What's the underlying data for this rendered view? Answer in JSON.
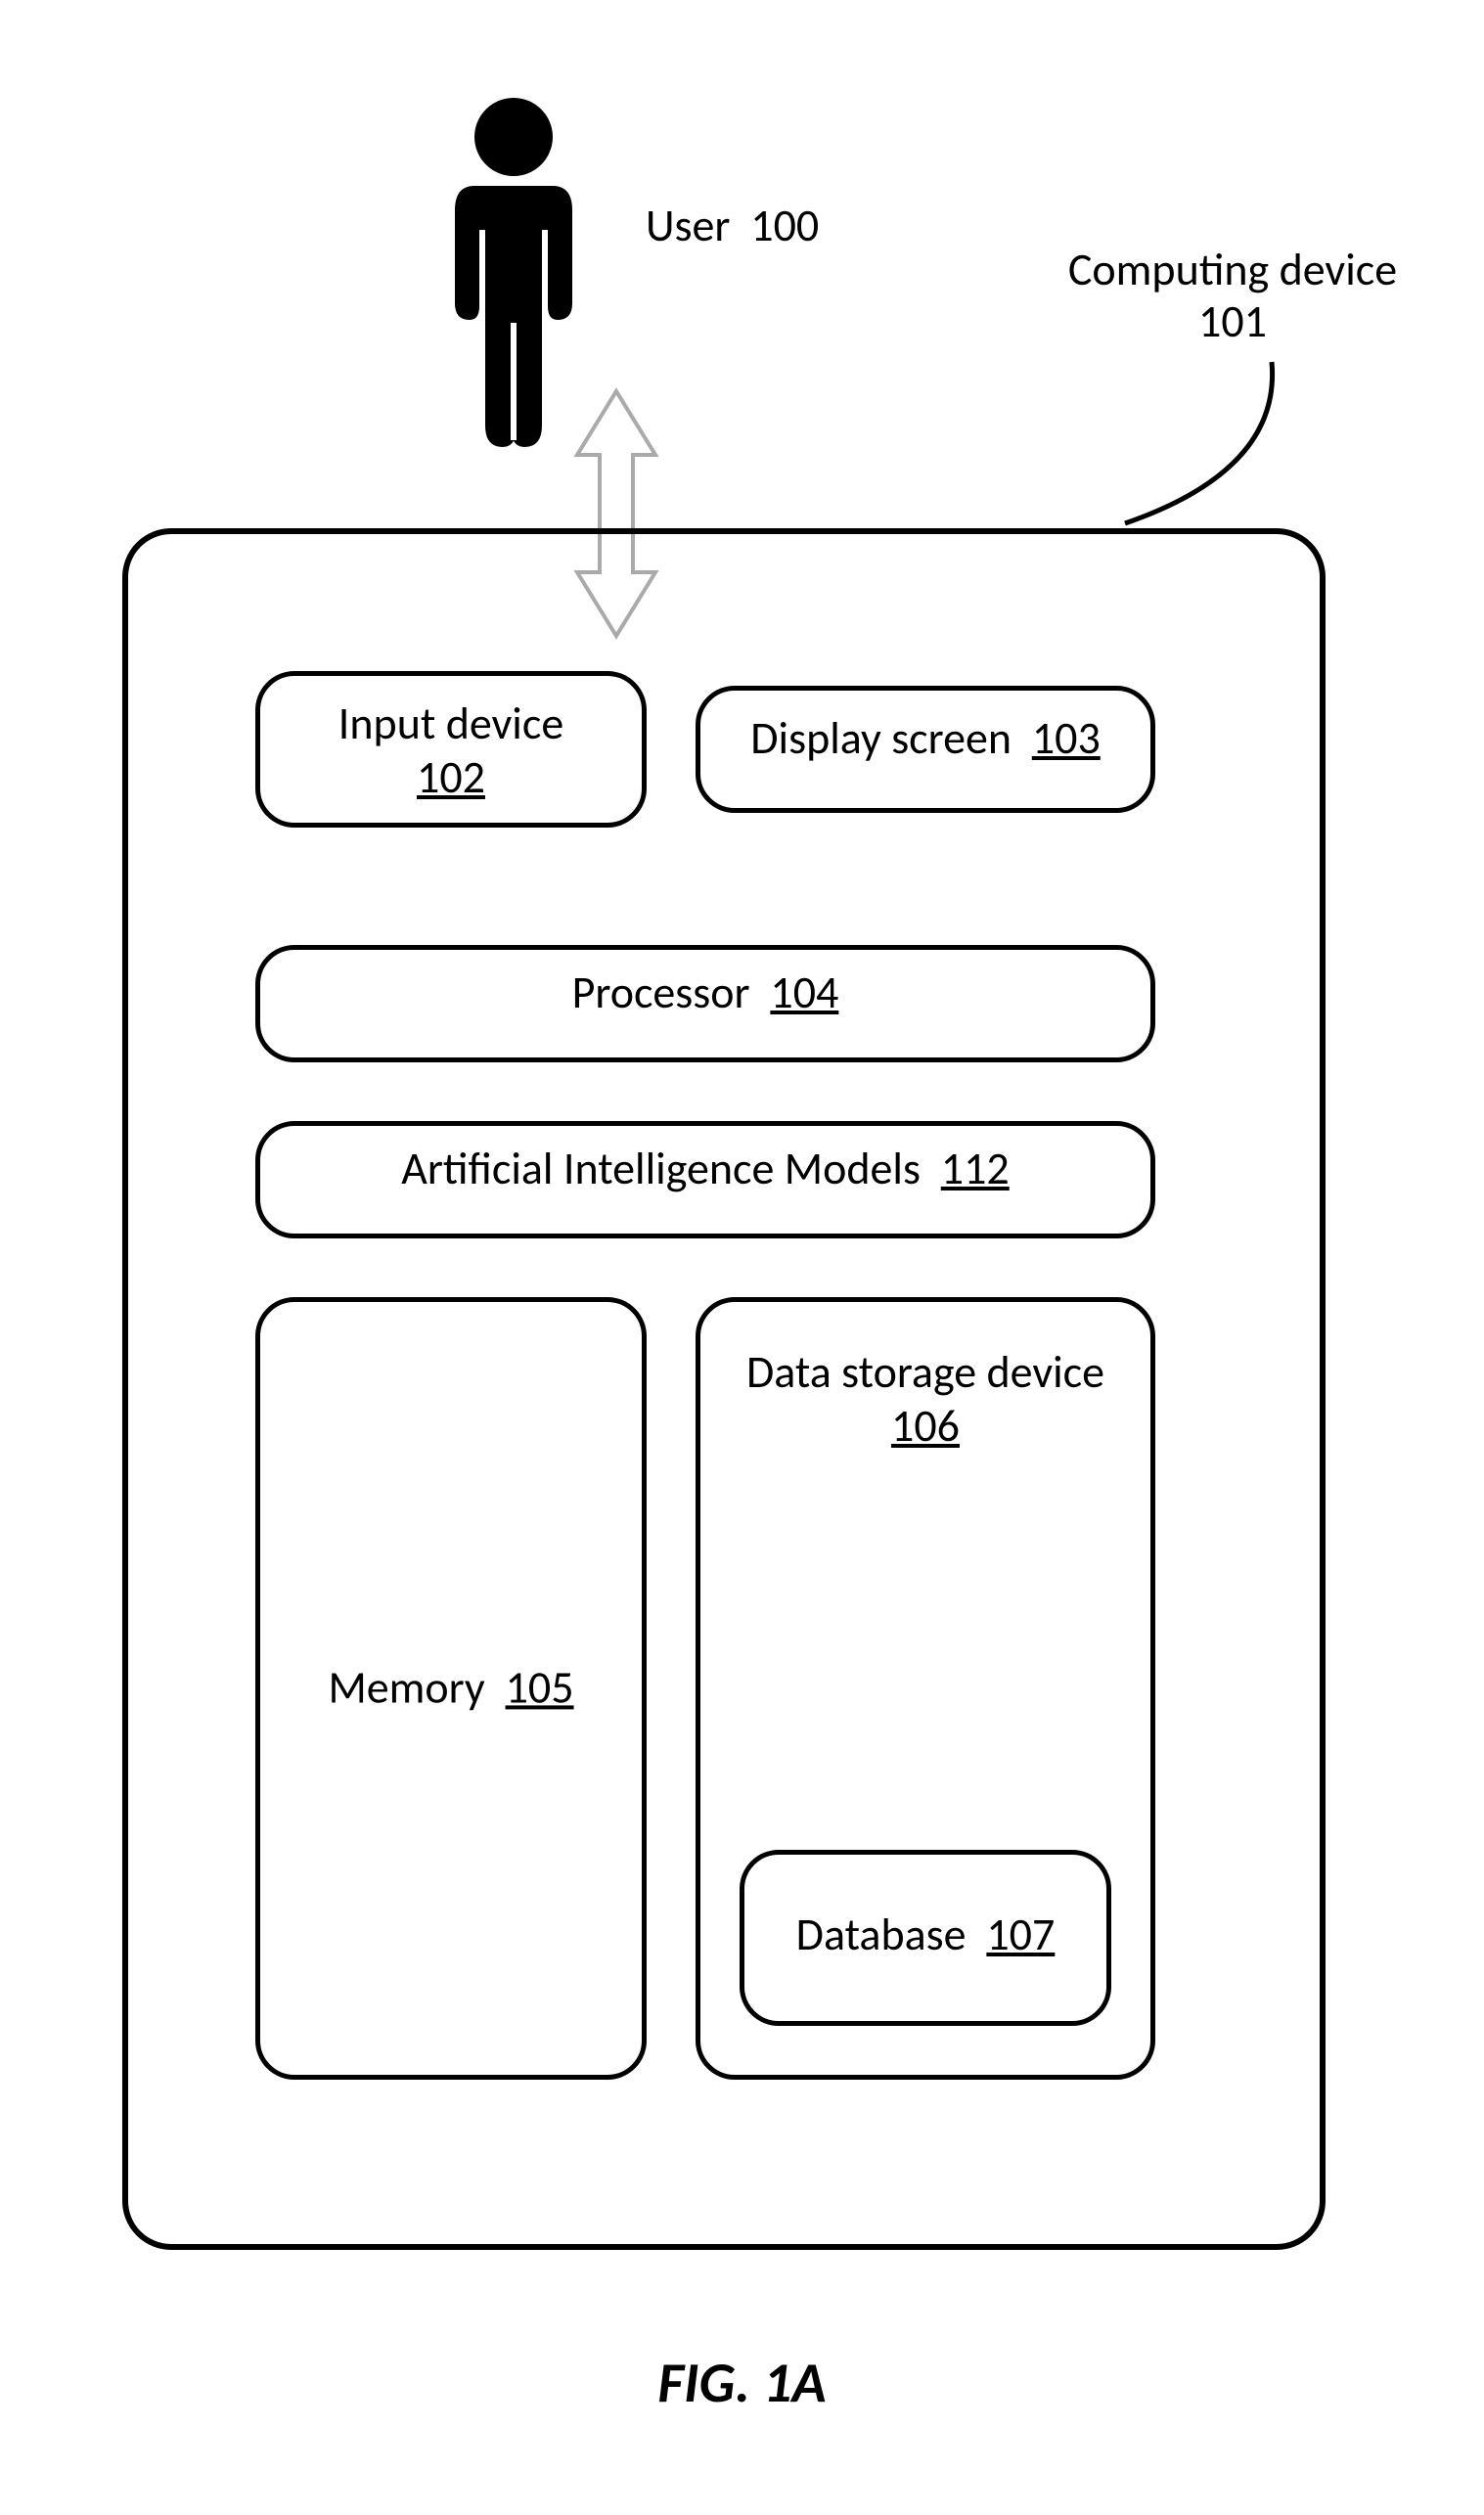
{
  "labels": {
    "user": "User",
    "user_num": "100",
    "device": "Computing device",
    "device_num": "101",
    "input": "Input device",
    "input_num": "102",
    "display": "Display screen",
    "display_num": "103",
    "processor": "Processor",
    "processor_num": "104",
    "ai": "Artificial Intelligence Models",
    "ai_num": "112",
    "memory": "Memory",
    "memory_num": "105",
    "storage": "Data storage device",
    "storage_num": "106",
    "database": "Database",
    "database_num": "107"
  },
  "figure": "FIG. 1A"
}
